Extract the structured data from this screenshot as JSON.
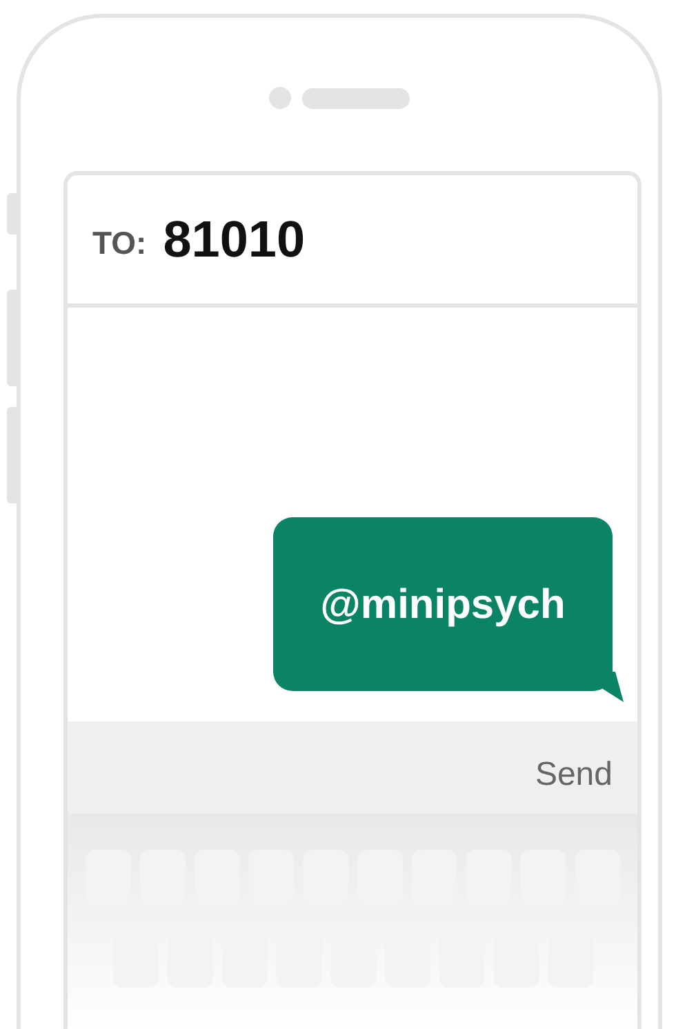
{
  "recipient": {
    "label": "TO:",
    "number": "81010"
  },
  "messages": [
    {
      "text": "@minipsych",
      "kind": "sent"
    }
  ],
  "send_button": {
    "label": "Send"
  }
}
